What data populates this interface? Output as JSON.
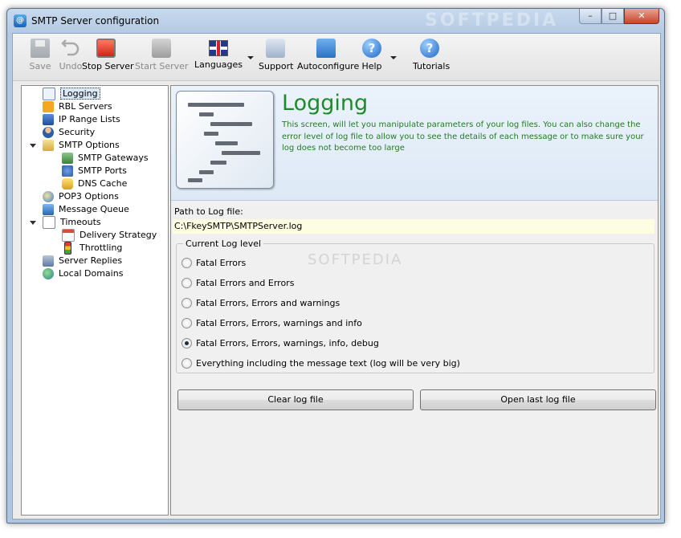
{
  "window": {
    "title": "SMTP Server configuration",
    "watermark": "SOFTPEDIA",
    "min_label": "–",
    "max_label": "□",
    "close_label": "✕"
  },
  "toolbar": {
    "save": "Save",
    "undo": "Undo",
    "stop_server": "Stop Server",
    "start_server": "Start Server",
    "languages": "Languages",
    "support": "Support",
    "autoconfigure": "Autoconfigure",
    "help": "Help",
    "tutorials": "Tutorials",
    "help_glyph": "?"
  },
  "tree": {
    "items": [
      {
        "label": "Logging",
        "icon": "logging-icon",
        "selected": true
      },
      {
        "label": "RBL Servers",
        "icon": "rbl-icon"
      },
      {
        "label": "IP Range Lists",
        "icon": "ip-range-icon"
      },
      {
        "label": "Security",
        "icon": "security-icon"
      },
      {
        "label": "SMTP Options",
        "icon": "smtp-options-icon",
        "expanded": true
      },
      {
        "label": "SMTP Gateways",
        "icon": "gateways-icon"
      },
      {
        "label": "SMTP Ports",
        "icon": "ports-icon"
      },
      {
        "label": "DNS Cache",
        "icon": "dns-cache-icon"
      },
      {
        "label": "POP3 Options",
        "icon": "pop3-icon"
      },
      {
        "label": "Message Queue",
        "icon": "queue-icon"
      },
      {
        "label": "Timeouts",
        "icon": "timeouts-icon",
        "expanded": true
      },
      {
        "label": "Delivery Strategy",
        "icon": "calendar-icon"
      },
      {
        "label": "Throttling",
        "icon": "traffic-light-icon"
      },
      {
        "label": "Server Replies",
        "icon": "server-replies-icon"
      },
      {
        "label": "Local Domains",
        "icon": "local-domains-icon"
      }
    ]
  },
  "header": {
    "title": "Logging",
    "description": "This screen, will let you manipulate parameters of your log files. You can also change the error level of log file to allow you to see the details of each message or to make sure your log does not become too large"
  },
  "log": {
    "path_label": "Path to Log file:",
    "path_value": "C:\\FkeySMTP\\SMTPServer.log",
    "group_label": "Current Log level",
    "levels": [
      "Fatal Errors",
      "Fatal Errors and Errors",
      "Fatal Errors, Errors and warnings",
      "Fatal Errors, Errors, warnings and  info",
      "Fatal Errors, Errors, warnings, info, debug",
      "Everything including the message text (log will be very big)"
    ],
    "selected_level": 4,
    "clear_button": "Clear log file",
    "open_button": "Open last log file"
  },
  "colors": {
    "header_title": "#1e8a2c",
    "header_text": "#227a22",
    "path_bg": "#fdfde2"
  }
}
